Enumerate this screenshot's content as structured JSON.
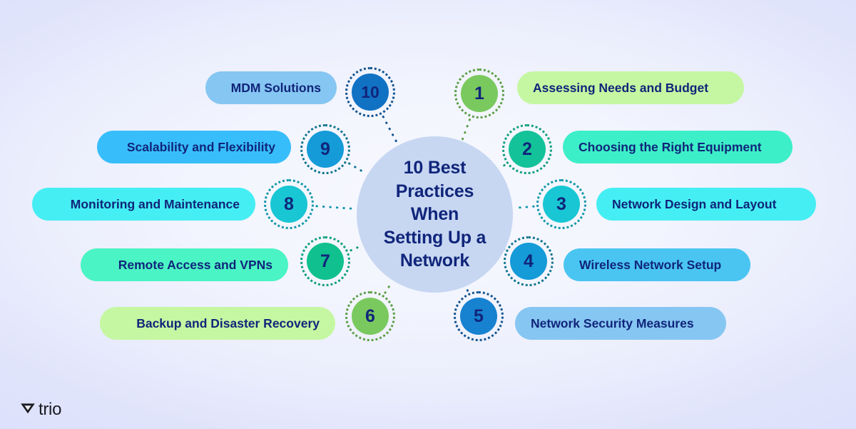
{
  "center": {
    "title": "10 Best\nPractices\nWhen\nSetting Up a\nNetwork",
    "circle_color": "#c7d7f2",
    "text_color": "#10257a"
  },
  "background": {
    "edge_color": "#dce0fb",
    "center_color": "#f7f8ff"
  },
  "logo": {
    "text": "trio",
    "mark": "triangle-logo-mark",
    "color": "#1b1b23"
  },
  "items": [
    {
      "number": "1",
      "label": "Assessing Needs and Budget",
      "side": "right",
      "badge_color": "#7ac95f",
      "pill_color": "#c5f7a2",
      "ring_color": "#5a9e47",
      "connector_color": "#5a9e47"
    },
    {
      "number": "2",
      "label": "Choosing the Right Equipment",
      "side": "right",
      "badge_color": "#14c29a",
      "pill_color": "#3defc8",
      "ring_color": "#0f9e7e",
      "connector_color": "#0f9e7e"
    },
    {
      "number": "3",
      "label": "Network Design and Layout",
      "side": "right",
      "badge_color": "#19c6d4",
      "pill_color": "#45eef3",
      "ring_color": "#1397a8",
      "connector_color": "#1397a8"
    },
    {
      "number": "4",
      "label": "Wireless Network Setup",
      "side": "right",
      "badge_color": "#159bd8",
      "pill_color": "#4ac5f2",
      "ring_color": "#10758f",
      "connector_color": "#10758f"
    },
    {
      "number": "5",
      "label": "Network Security Measures",
      "side": "right",
      "badge_color": "#1782d0",
      "pill_color": "#86c6f2",
      "ring_color": "#11538f",
      "connector_color": "#11538f"
    },
    {
      "number": "6",
      "label": "Backup and Disaster Recovery",
      "side": "left",
      "badge_color": "#7ac95f",
      "pill_color": "#c5f7a2",
      "ring_color": "#5a9e47",
      "connector_color": "#5a9e47"
    },
    {
      "number": "7",
      "label": "Remote Access and VPNs",
      "side": "left",
      "badge_color": "#10c08e",
      "pill_color": "#4bf4c4",
      "ring_color": "#0f9e7e",
      "connector_color": "#0f9e7e"
    },
    {
      "number": "8",
      "label": "Monitoring and Maintenance",
      "side": "left",
      "badge_color": "#19c6d4",
      "pill_color": "#45eef3",
      "ring_color": "#1397a8",
      "connector_color": "#1397a8"
    },
    {
      "number": "9",
      "label": "Scalability and Flexibility",
      "side": "left",
      "badge_color": "#159bd8",
      "pill_color": "#37befa",
      "ring_color": "#10758f",
      "connector_color": "#10758f"
    },
    {
      "number": "10",
      "label": "MDM Solutions",
      "side": "left",
      "badge_color": "#1172c4",
      "pill_color": "#86c6f2",
      "ring_color": "#11538f",
      "connector_color": "#11538f"
    }
  ]
}
